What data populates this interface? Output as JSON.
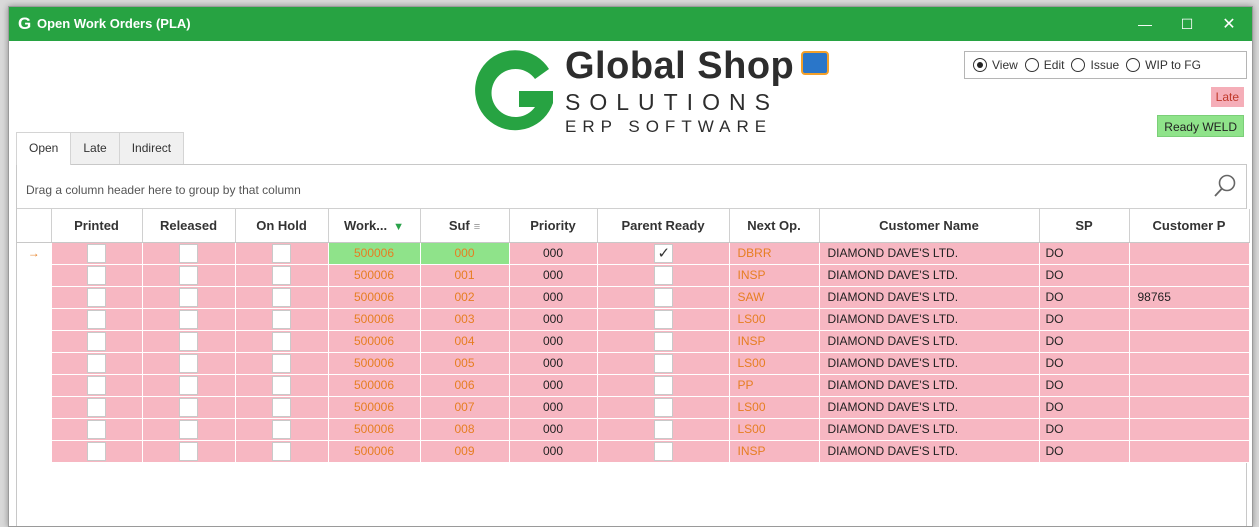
{
  "window": {
    "title": "Open Work Orders (PLA)",
    "app_icon": "G",
    "controls": {
      "minimize": "—",
      "maximize": "☐",
      "close": "✕"
    }
  },
  "logo": {
    "brand": "Global Shop",
    "line2": "SOLUTIONS",
    "line3": "ERP SOFTWARE",
    "brand_color": "#27a342"
  },
  "modes": [
    {
      "label": "View",
      "checked": true
    },
    {
      "label": "Edit",
      "checked": false
    },
    {
      "label": "Issue",
      "checked": false
    },
    {
      "label": "WIP to FG",
      "checked": false
    }
  ],
  "legend": {
    "late": "Late",
    "ready": "Ready WELD"
  },
  "tabs": [
    {
      "label": "Open",
      "active": true
    },
    {
      "label": "Late",
      "active": false
    },
    {
      "label": "Indirect",
      "active": false
    }
  ],
  "grid": {
    "group_hint": "Drag a column header here to group by that column",
    "columns": [
      "Printed",
      "Released",
      "On Hold",
      "Work...",
      "Suf",
      "Priority",
      "Parent Ready",
      "Next Op.",
      "Customer Name",
      "SP",
      "Customer P"
    ],
    "rows": [
      {
        "current": true,
        "work": "500006",
        "suf": "000",
        "priority": "000",
        "parent_ready": true,
        "next_op": "DBRR",
        "customer": "DIAMOND DAVE'S LTD.",
        "sp": "DO",
        "customer_p": ""
      },
      {
        "current": false,
        "work": "500006",
        "suf": "001",
        "priority": "000",
        "parent_ready": false,
        "next_op": "INSP",
        "customer": "DIAMOND DAVE'S LTD.",
        "sp": "DO",
        "customer_p": ""
      },
      {
        "current": false,
        "work": "500006",
        "suf": "002",
        "priority": "000",
        "parent_ready": false,
        "next_op": "SAW",
        "customer": "DIAMOND DAVE'S LTD.",
        "sp": "DO",
        "customer_p": "98765"
      },
      {
        "current": false,
        "work": "500006",
        "suf": "003",
        "priority": "000",
        "parent_ready": false,
        "next_op": "LS00",
        "customer": "DIAMOND DAVE'S LTD.",
        "sp": "DO",
        "customer_p": ""
      },
      {
        "current": false,
        "work": "500006",
        "suf": "004",
        "priority": "000",
        "parent_ready": false,
        "next_op": "INSP",
        "customer": "DIAMOND DAVE'S LTD.",
        "sp": "DO",
        "customer_p": ""
      },
      {
        "current": false,
        "work": "500006",
        "suf": "005",
        "priority": "000",
        "parent_ready": false,
        "next_op": "LS00",
        "customer": "DIAMOND DAVE'S LTD.",
        "sp": "DO",
        "customer_p": ""
      },
      {
        "current": false,
        "work": "500006",
        "suf": "006",
        "priority": "000",
        "parent_ready": false,
        "next_op": "PP",
        "customer": "DIAMOND DAVE'S LTD.",
        "sp": "DO",
        "customer_p": ""
      },
      {
        "current": false,
        "work": "500006",
        "suf": "007",
        "priority": "000",
        "parent_ready": false,
        "next_op": "LS00",
        "customer": "DIAMOND DAVE'S LTD.",
        "sp": "DO",
        "customer_p": ""
      },
      {
        "current": false,
        "work": "500006",
        "suf": "008",
        "priority": "000",
        "parent_ready": false,
        "next_op": "LS00",
        "customer": "DIAMOND DAVE'S LTD.",
        "sp": "DO",
        "customer_p": ""
      },
      {
        "current": false,
        "work": "500006",
        "suf": "009",
        "priority": "000",
        "parent_ready": false,
        "next_op": "INSP",
        "customer": "DIAMOND DAVE'S LTD.",
        "sp": "DO",
        "customer_p": ""
      }
    ]
  },
  "colors": {
    "titlebar": "#27a342",
    "late_row": "#f7b7c2",
    "ready_cell": "#8fe38a",
    "late_text": "#e67e22"
  },
  "icons": {
    "row_indicator": "arrow-right-icon",
    "search": "search-icon",
    "filter": "filter-icon",
    "sort": "sort-icon",
    "logo": "global-shop-logo"
  }
}
